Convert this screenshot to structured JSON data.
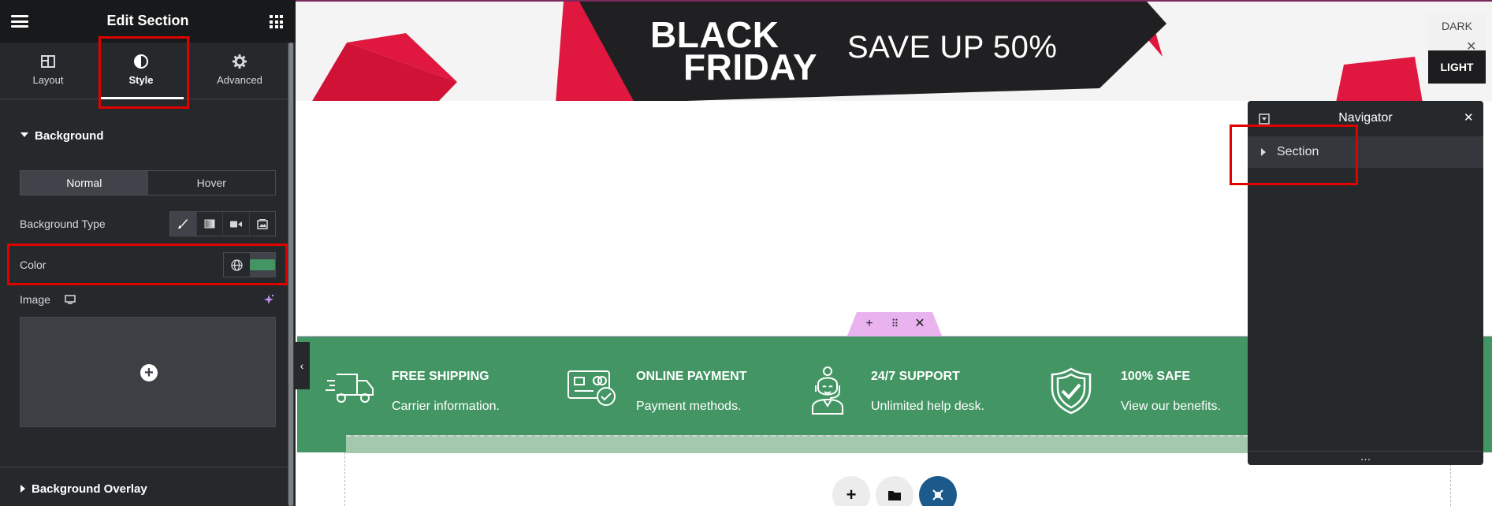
{
  "panel": {
    "title": "Edit Section",
    "tabs": [
      {
        "label": "Layout",
        "icon": "columns-icon"
      },
      {
        "label": "Style",
        "icon": "half-circle-icon",
        "active": true
      },
      {
        "label": "Advanced",
        "icon": "gear-icon"
      }
    ],
    "background_section": {
      "title": "Background",
      "states": [
        "Normal",
        "Hover"
      ],
      "active_state": "Normal",
      "background_type_label": "Background Type",
      "background_types": [
        "brush-icon",
        "gradient-icon",
        "video-icon",
        "slideshow-icon"
      ],
      "color_label": "Color",
      "color_value": "#439664",
      "image_label": "Image"
    },
    "overlay_section": {
      "title": "Background Overlay"
    }
  },
  "canvas": {
    "banner": {
      "line1": "BLACK",
      "line2": "FRIDAY",
      "promo": "SAVE UP 50%"
    },
    "mode_switch": {
      "dark": "DARK",
      "light": "LIGHT"
    },
    "features": [
      {
        "title": "FREE SHIPPING",
        "desc": "Carrier information.",
        "icon": "truck-icon"
      },
      {
        "title": "ONLINE PAYMENT",
        "desc": "Payment methods.",
        "icon": "credit-card-icon"
      },
      {
        "title": "24/7 SUPPORT",
        "desc": "Unlimited help desk.",
        "icon": "support-agent-icon"
      },
      {
        "title": "100% SAFE",
        "desc": "View our benefits.",
        "icon": "shield-check-icon"
      }
    ],
    "background_color": "#439664"
  },
  "navigator": {
    "title": "Navigator",
    "items": [
      {
        "label": "Section"
      }
    ]
  },
  "colors": {
    "panel_bg": "#26292c",
    "accent_green": "#439664",
    "highlight_red": "#e00000"
  }
}
